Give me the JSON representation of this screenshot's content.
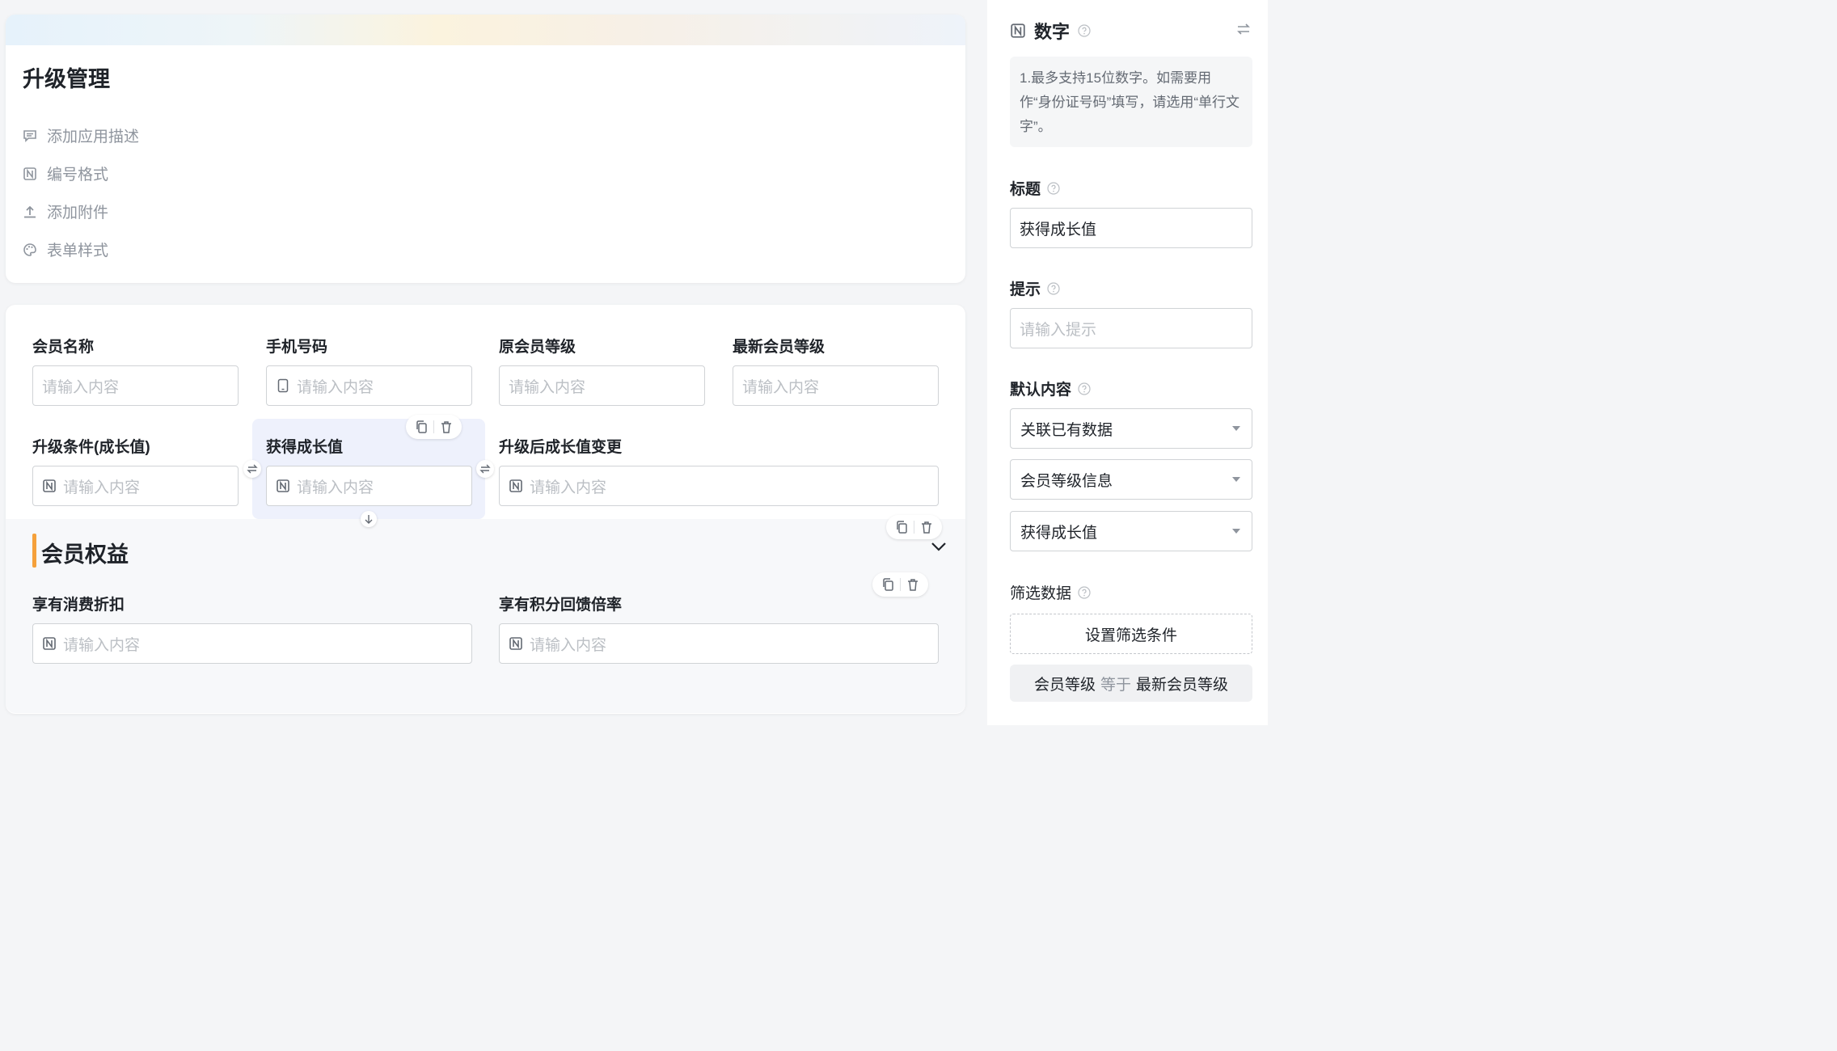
{
  "app": {
    "title": "升级管理",
    "meta": [
      {
        "label": "添加应用描述",
        "icon": "comment-icon"
      },
      {
        "label": "编号格式",
        "icon": "number-icon"
      },
      {
        "label": "添加附件",
        "icon": "upload-icon"
      },
      {
        "label": "表单样式",
        "icon": "palette-icon"
      }
    ]
  },
  "form": {
    "fields": [
      {
        "label": "会员名称",
        "placeholder": "请输入内容"
      },
      {
        "label": "手机号码",
        "placeholder": "请输入内容"
      },
      {
        "label": "原会员等级",
        "placeholder": "请输入内容"
      },
      {
        "label": "最新会员等级",
        "placeholder": "请输入内容"
      },
      {
        "label": "升级条件(成长值)",
        "placeholder": "请输入内容"
      },
      {
        "label": "获得成长值",
        "placeholder": "请输入内容"
      },
      {
        "label": "升级后成长值变更",
        "placeholder": "请输入内容"
      }
    ],
    "section": {
      "title": "会员权益",
      "fields": [
        {
          "label": "享有消费折扣",
          "placeholder": "请输入内容"
        },
        {
          "label": "享有积分回馈倍率",
          "placeholder": "请输入内容"
        }
      ]
    }
  },
  "panel": {
    "type_title": "数字",
    "tip": "1.最多支持15位数字。如需要用作“身份证号码”填写，请选用“单行文字”。",
    "title_label": "标题",
    "title_value": "获得成长值",
    "hint_label": "提示",
    "hint_placeholder": "请输入提示",
    "default_label": "默认内容",
    "default_selects": [
      "关联已有数据",
      "会员等级信息",
      "获得成长值"
    ],
    "filter_label": "筛选数据",
    "filter_button": "设置筛选条件",
    "condition": {
      "field": "会员等级",
      "operator": "等于",
      "value": "最新会员等级"
    }
  },
  "colors": {
    "accent": "#f5a13b",
    "selected_bg": "#eef1fc",
    "placeholder": "#bbbfc4"
  }
}
